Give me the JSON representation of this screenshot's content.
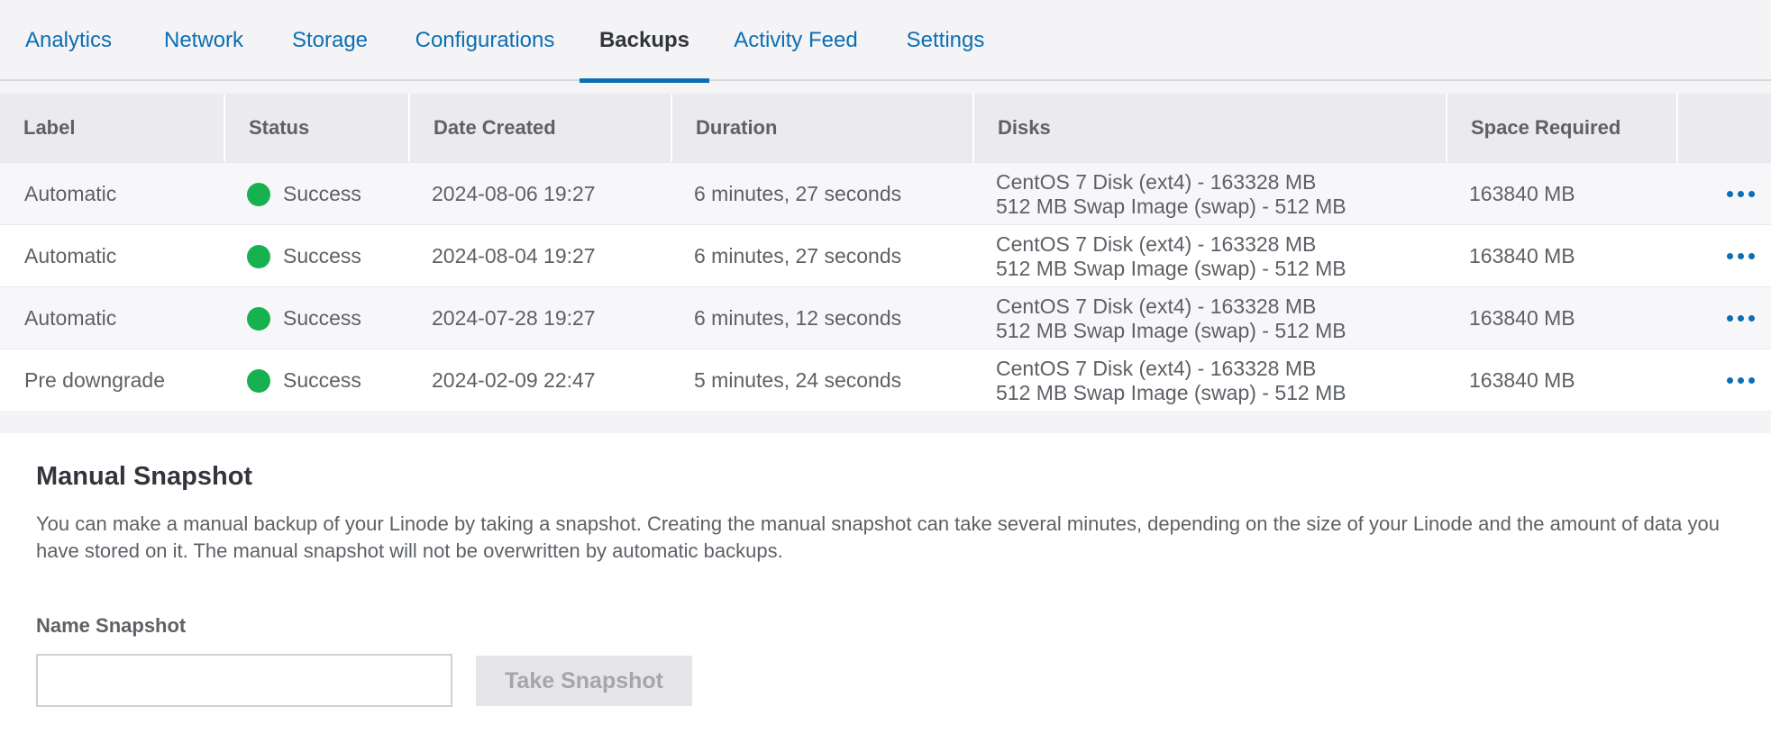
{
  "tabs": [
    {
      "label": "Analytics",
      "active": false
    },
    {
      "label": "Network",
      "active": false
    },
    {
      "label": "Storage",
      "active": false
    },
    {
      "label": "Configurations",
      "active": false
    },
    {
      "label": "Backups",
      "active": true
    },
    {
      "label": "Activity Feed",
      "active": false
    },
    {
      "label": "Settings",
      "active": false
    }
  ],
  "table": {
    "headers": [
      "Label",
      "Status",
      "Date Created",
      "Duration",
      "Disks",
      "Space Required"
    ],
    "rows": [
      {
        "label": "Automatic",
        "status": "Success",
        "date": "2024-08-06 19:27",
        "duration": "6 minutes, 27 seconds",
        "disk1": "CentOS 7 Disk (ext4) - 163328 MB",
        "disk2": "512 MB Swap Image (swap) - 512 MB",
        "space": "163840 MB"
      },
      {
        "label": "Automatic",
        "status": "Success",
        "date": "2024-08-04 19:27",
        "duration": "6 minutes, 27 seconds",
        "disk1": "CentOS 7 Disk (ext4) - 163328 MB",
        "disk2": "512 MB Swap Image (swap) - 512 MB",
        "space": "163840 MB"
      },
      {
        "label": "Automatic",
        "status": "Success",
        "date": "2024-07-28 19:27",
        "duration": "6 minutes, 12 seconds",
        "disk1": "CentOS 7 Disk (ext4) - 163328 MB",
        "disk2": "512 MB Swap Image (swap) - 512 MB",
        "space": "163840 MB"
      },
      {
        "label": "Pre downgrade",
        "status": "Success",
        "date": "2024-02-09 22:47",
        "duration": "5 minutes, 24 seconds",
        "disk1": "CentOS 7 Disk (ext4) - 163328 MB",
        "disk2": "512 MB Swap Image (swap) - 512 MB",
        "space": "163840 MB"
      }
    ],
    "status_color": "#17b24f",
    "action_icon": "more-horizontal-icon"
  },
  "snapshot": {
    "title": "Manual Snapshot",
    "description": "You can make a manual backup of your Linode by taking a snapshot. Creating the manual snapshot can take several minutes, depending on the size of your Linode and the amount of data you have stored on it. The manual snapshot will not be overwritten by automatic backups.",
    "name_label": "Name Snapshot",
    "name_value": "",
    "button_label": "Take Snapshot"
  },
  "colors": {
    "accent": "#0c6fb3",
    "success": "#17b24f"
  }
}
